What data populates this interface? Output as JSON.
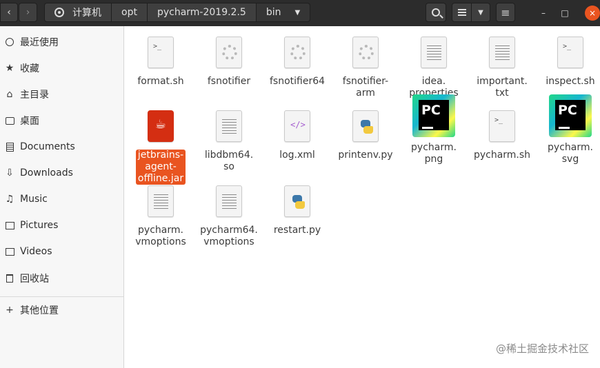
{
  "header": {
    "back_glyph": "‹",
    "forward_glyph": "›",
    "breadcrumbs": [
      {
        "label": "计算机",
        "icon": "drive-icon"
      },
      {
        "label": "opt"
      },
      {
        "label": "pycharm-2019.2.5"
      },
      {
        "label": "bin",
        "caret": "▼"
      }
    ],
    "window": {
      "minimize": "–",
      "maximize": "□",
      "close": "×"
    },
    "view_caret": "▼",
    "menu_glyph": "≡"
  },
  "sidebar": {
    "items": [
      {
        "label": "最近使用",
        "icon": "clock-icon"
      },
      {
        "label": "收藏",
        "icon": "star-icon"
      },
      {
        "label": "主目录",
        "icon": "home-icon"
      },
      {
        "label": "桌面",
        "icon": "desktop-icon"
      },
      {
        "label": "Documents",
        "icon": "documents-icon"
      },
      {
        "label": "Downloads",
        "icon": "download-icon"
      },
      {
        "label": "Music",
        "icon": "music-icon"
      },
      {
        "label": "Pictures",
        "icon": "pictures-icon"
      },
      {
        "label": "Videos",
        "icon": "videos-icon"
      },
      {
        "label": "回收站",
        "icon": "trash-icon"
      },
      {
        "label": "其他位置",
        "icon": "plus-icon"
      }
    ]
  },
  "files": [
    {
      "label": "format.sh",
      "type": "script"
    },
    {
      "label": "fsnotifier",
      "type": "binary"
    },
    {
      "label": "fsnotifier64",
      "type": "binary"
    },
    {
      "label": "fsnotifier-arm",
      "type": "binary"
    },
    {
      "label": "idea.\nproperties",
      "type": "text"
    },
    {
      "label": "important.\ntxt",
      "type": "text"
    },
    {
      "label": "inspect.sh",
      "type": "script"
    },
    {
      "label": "jetbrains-\nagent-\noffline.jar",
      "type": "jar",
      "selected": true
    },
    {
      "label": "libdbm64.\nso",
      "type": "text"
    },
    {
      "label": "log.xml",
      "type": "xml"
    },
    {
      "label": "printenv.py",
      "type": "python"
    },
    {
      "label": "pycharm.\npng",
      "type": "pycharm"
    },
    {
      "label": "pycharm.sh",
      "type": "script"
    },
    {
      "label": "pycharm.\nsvg",
      "type": "pycharm"
    },
    {
      "label": "pycharm.\nvmoptions",
      "type": "text"
    },
    {
      "label": "pycharm64.\nvmoptions",
      "type": "text"
    },
    {
      "label": "restart.py",
      "type": "python"
    }
  ],
  "pycharm_icon_text": "PC",
  "xml_icon_text": "</>",
  "script_icon_text": ">_",
  "watermark": "@稀土掘金技术社区",
  "colors": {
    "accent": "#e95420",
    "header": "#2c2c2c",
    "sidebar": "#f7f7f7"
  }
}
